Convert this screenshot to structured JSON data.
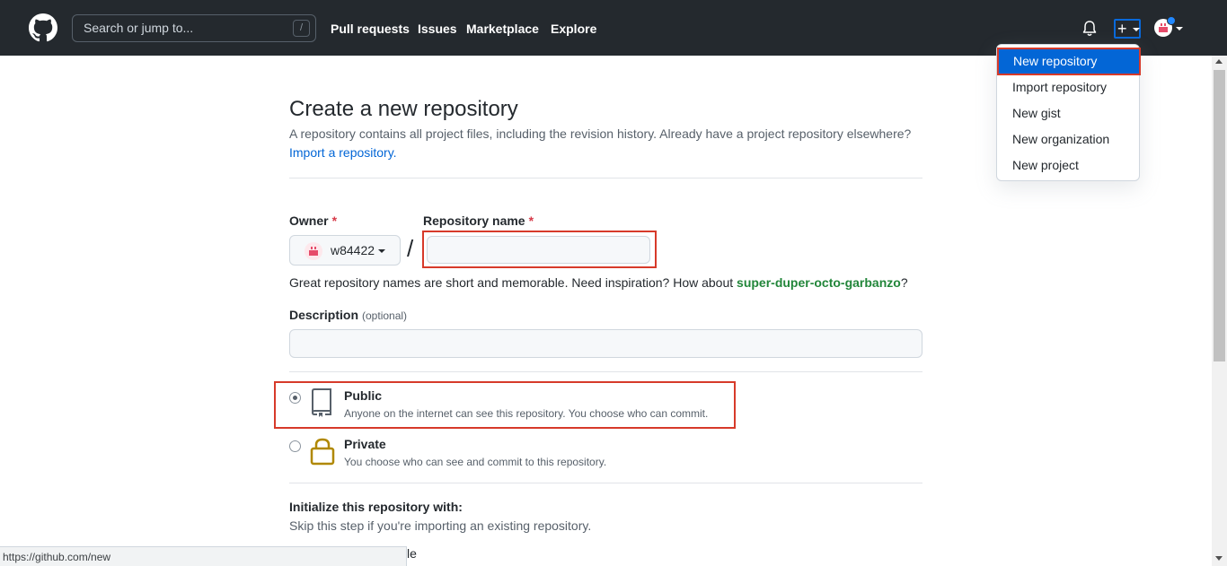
{
  "header": {
    "search_placeholder": "Search or jump to...",
    "search_shortcut": "/",
    "nav": [
      "Pull requests",
      "Issues",
      "Marketplace",
      "Explore"
    ]
  },
  "dropdown": {
    "items": [
      "New repository",
      "Import repository",
      "New gist",
      "New organization",
      "New project"
    ]
  },
  "page": {
    "title": "Create a new repository",
    "subtitle": "A repository contains all project files, including the revision history. Already have a project repository elsewhere?",
    "import_link": "Import a repository.",
    "owner_label": "Owner",
    "required_mark": "*",
    "owner_value": "w84422",
    "separator": "/",
    "repo_name_label": "Repository name",
    "hint_prefix": "Great repository names are short and memorable. Need inspiration? How about ",
    "hint_suggestion": "super-duper-octo-garbanzo",
    "hint_suffix": "?",
    "description_label": "Description",
    "description_optional": "(optional)",
    "visibility": {
      "public_title": "Public",
      "public_desc": "Anyone on the internet can see this repository. You choose who can commit.",
      "private_title": "Private",
      "private_desc": "You choose who can see and commit to this repository.",
      "selected": "Public"
    },
    "init_title": "Initialize this repository with:",
    "init_sub": "Skip this step if you're importing an existing repository.",
    "partial_text": "le"
  },
  "statusbar": {
    "url": "https://github.com/new"
  },
  "colors": {
    "header_bg": "#24292e",
    "accent": "#0366d6",
    "highlight": "#d73a2a",
    "success": "#22863a"
  }
}
